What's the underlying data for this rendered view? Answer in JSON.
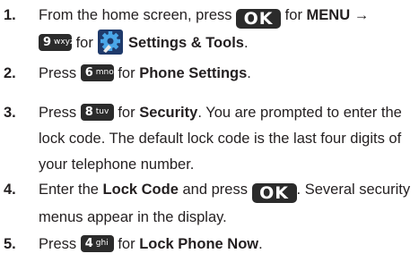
{
  "steps": [
    {
      "number": "1.",
      "lines": [
        {
          "parts": [
            {
              "type": "text",
              "text": "From the home screen, press "
            },
            {
              "type": "key",
              "key": "ok",
              "label": "OK"
            },
            {
              "type": "text",
              "text": " for "
            },
            {
              "type": "bold",
              "text": "MENU"
            },
            {
              "type": "text",
              "text": " →"
            }
          ]
        },
        {
          "parts": [
            {
              "type": "key",
              "key": "num",
              "digit": "9",
              "letters": "wxyz"
            },
            {
              "type": "text",
              "text": " for "
            },
            {
              "type": "icon",
              "name": "settings-tools-icon"
            },
            {
              "type": "text",
              "text": " "
            },
            {
              "type": "bold",
              "text": "Settings & Tools"
            },
            {
              "type": "text",
              "text": "."
            }
          ]
        }
      ]
    },
    {
      "number": "2.",
      "lines": [
        {
          "parts": [
            {
              "type": "text",
              "text": "Press "
            },
            {
              "type": "key",
              "key": "num",
              "digit": "6",
              "letters": "mno"
            },
            {
              "type": "text",
              "text": " for "
            },
            {
              "type": "bold",
              "text": "Phone Settings"
            },
            {
              "type": "text",
              "text": "."
            }
          ]
        }
      ]
    },
    {
      "number": "3.",
      "lines": [
        {
          "parts": [
            {
              "type": "text",
              "text": "Press "
            },
            {
              "type": "key",
              "key": "num",
              "digit": "8",
              "letters": "tuv"
            },
            {
              "type": "text",
              "text": " for "
            },
            {
              "type": "bold",
              "text": "Security"
            },
            {
              "type": "text",
              "text": ". You are prompted to enter the"
            }
          ]
        },
        {
          "parts": [
            {
              "type": "text",
              "text": "lock code. The default lock code is the last four digits of"
            }
          ]
        },
        {
          "parts": [
            {
              "type": "text",
              "text": "your telephone number."
            }
          ]
        }
      ]
    },
    {
      "number": "4.",
      "lines": [
        {
          "parts": [
            {
              "type": "text",
              "text": "Enter the "
            },
            {
              "type": "bold",
              "text": "Lock Code"
            },
            {
              "type": "text",
              "text": " and press "
            },
            {
              "type": "key",
              "key": "ok",
              "label": "OK"
            },
            {
              "type": "text",
              "text": ". Several security"
            }
          ]
        },
        {
          "parts": [
            {
              "type": "text",
              "text": "menus appear in the display."
            }
          ]
        }
      ]
    },
    {
      "number": "5.",
      "lines": [
        {
          "parts": [
            {
              "type": "text",
              "text": "Press "
            },
            {
              "type": "key",
              "key": "num",
              "digit": "4",
              "letters": "ghi"
            },
            {
              "type": "text",
              "text": " for "
            },
            {
              "type": "bold",
              "text": "Lock Phone Now"
            },
            {
              "type": "text",
              "text": "."
            }
          ]
        }
      ]
    }
  ]
}
